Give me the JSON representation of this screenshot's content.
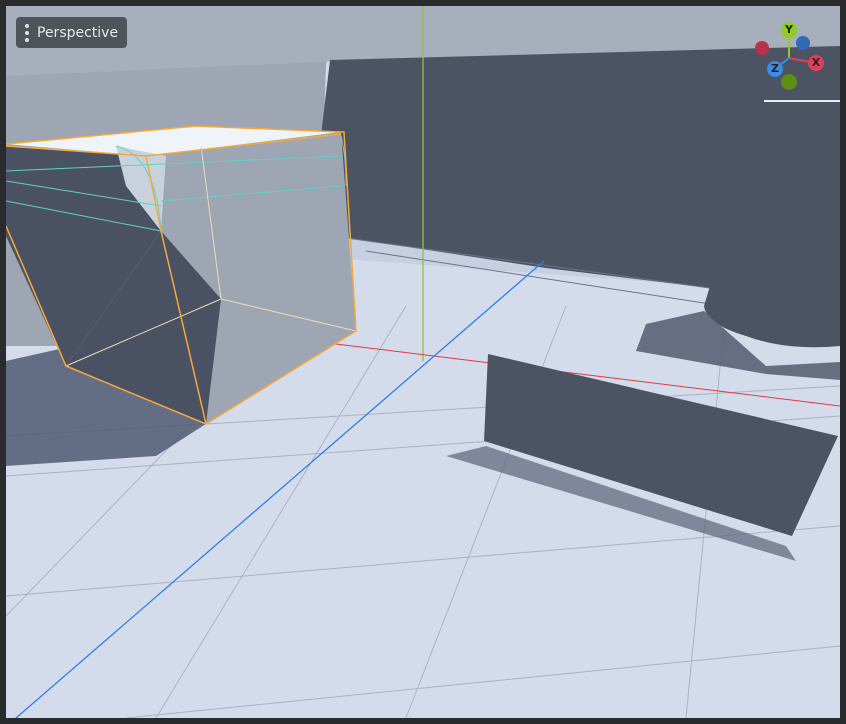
{
  "viewport": {
    "view_mode_label": "Perspective",
    "view_menu_icon": "kebab-menu-icon"
  },
  "gizmo": {
    "y_label": "Y",
    "x_label": "X",
    "z_label": "Z",
    "colors": {
      "x": "#e2405a",
      "y": "#8fcd1e",
      "z": "#3a8ce8",
      "neg_x": "#b8334a",
      "neg_y": "#5e8e14",
      "neg_z": "#2d6bb4"
    }
  },
  "colors": {
    "floor": "#d4dcec",
    "wall_dark": "#4c5363",
    "wall_light": "#9ea5b3",
    "selection": "#f4a83a",
    "edge_highlight": "#5fd1c6",
    "axis_x": "#e03a3a",
    "axis_y": "#88c83a",
    "axis_z": "#2f7ef0"
  }
}
